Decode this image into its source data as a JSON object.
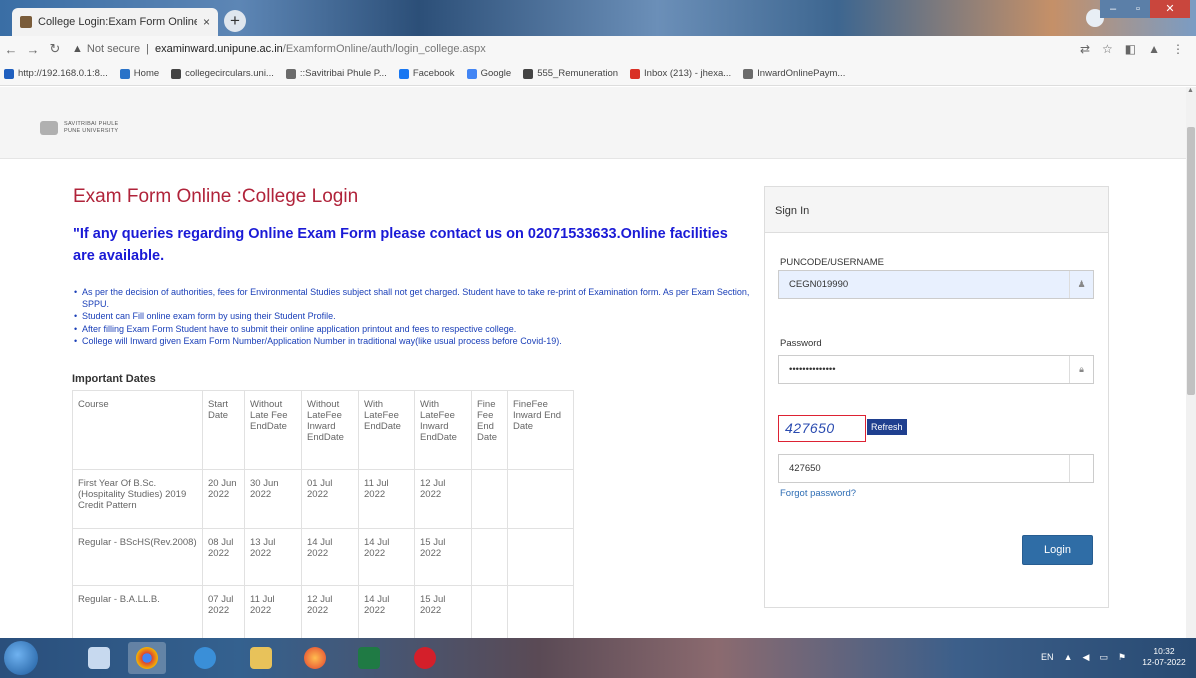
{
  "browser": {
    "tab_title": "College Login:Exam Form Online",
    "tab_close": "×",
    "new_tab": "+",
    "address": {
      "not_secure": "Not secure",
      "host": "examinward.unipune.ac.in",
      "path": "/ExamformOnline/auth/login_college.aspx"
    },
    "bookmarks": [
      {
        "label": "http://192.168.0.1:8...",
        "color": "#1f5fbf"
      },
      {
        "label": "Home",
        "color": "#2a73c8"
      },
      {
        "label": "collegecirculars.uni...",
        "color": "#444444"
      },
      {
        "label": "::Savitribai Phule P...",
        "color": "#6b6b6b"
      },
      {
        "label": "Facebook",
        "color": "#1877f2"
      },
      {
        "label": "Google",
        "color": "#4285f4"
      },
      {
        "label": "555_Remuneration",
        "color": "#444444"
      },
      {
        "label": "Inbox (213) - jhexa...",
        "color": "#d93025"
      },
      {
        "label": "InwardOnlinePaym...",
        "color": "#6b6b6b"
      }
    ]
  },
  "header": {
    "logo_line1": "SAVITRIBAI PHULE",
    "logo_line2": "PUNE UNIVERSITY"
  },
  "main": {
    "title": "Exam Form Online :College Login",
    "notice": "\"If any queries regarding Online Exam Form please contact us on 02071533633.Online facilities are available.",
    "info_items": [
      "As per the decision of authorities, fees for Environmental Studies  subject shall not get charged. Student have to take re-print of Examination form. As per Exam Section, SPPU.",
      "Student can Fill online exam form by using their Student Profile.",
      "After filling Exam Form Student have to submit their online application printout and fees to respective college.",
      "College will Inward given Exam Form Number/Application Number in traditional way(like usual process before Covid-19)."
    ],
    "important_dates_title": "Important Dates",
    "table": {
      "headers": [
        "Course",
        "Start Date",
        "Without Late Fee EndDate",
        "Without LateFee Inward EndDate",
        "With LateFee EndDate",
        "With LateFee Inward EndDate",
        "Fine Fee End Date",
        "FineFee Inward End Date"
      ],
      "rows": [
        [
          "First Year Of B.Sc. (Hospitality Studies) 2019 Credit Pattern",
          "20 Jun 2022",
          "30 Jun 2022",
          "01 Jul 2022",
          "11 Jul 2022",
          "12 Jul 2022",
          "",
          ""
        ],
        [
          "Regular - BScHS(Rev.2008)",
          "08 Jul 2022",
          "13 Jul 2022",
          "14 Jul 2022",
          "14 Jul 2022",
          "15 Jul 2022",
          "",
          ""
        ],
        [
          "Regular - B.A.LL.B.",
          "07 Jul 2022",
          "11 Jul 2022",
          "12 Jul 2022",
          "14 Jul 2022",
          "15 Jul 2022",
          "",
          ""
        ]
      ]
    }
  },
  "signin": {
    "heading": "Sign In",
    "username_label": "PUNCODE/USERNAME",
    "username_value": "CEGN019990",
    "password_label": "Password",
    "password_value": "••••••••••••••",
    "captcha_text": "427650",
    "refresh_label": "Refresh",
    "captcha_input_value": "427650",
    "forgot_label": "Forgot password?",
    "login_label": "Login"
  },
  "taskbar": {
    "lang": "EN",
    "time": "10:32",
    "date": "12-07-2022"
  },
  "colors": {
    "title_red": "#b0233a",
    "notice_blue": "#1a1ad6",
    "info_blue": "#1a3fb8",
    "login_blue": "#2f6da6"
  }
}
